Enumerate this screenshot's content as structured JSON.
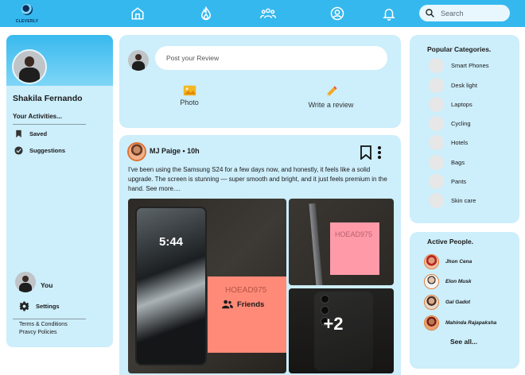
{
  "brand": {
    "name": "CLEVERLY"
  },
  "nav": {
    "search_placeholder": "Search"
  },
  "profile": {
    "name": "Shakila Fernando",
    "activities_title": "Your Activities...",
    "items": [
      {
        "label": "Saved",
        "icon": "bookmark-icon"
      },
      {
        "label": "Suggestions",
        "icon": "check-circle-icon"
      }
    ],
    "you_label": "You",
    "settings_label": "Settings",
    "terms_label": "Terms & Conditions",
    "privacy_label": "Pravcy Policies"
  },
  "composer": {
    "placeholder": "Post your Review",
    "photo_label": "Photo",
    "review_label": "Write a review"
  },
  "post": {
    "author": "MJ Paige",
    "time": "10h",
    "text": "I've been using the Samsung S24 for a few days now, and honestly, it feels like a solid  upgrade. The screen is stunning — super smooth and bright, and it just feels premium in the hand. See more....",
    "phone_time": "5:44",
    "friends_label": "Friends",
    "more_photos": "+2"
  },
  "categories": {
    "title": "Popular Categories.",
    "items": [
      "Smart Phones",
      "Desk light",
      "Laptops",
      "Cycling",
      "Hotels",
      "Bags",
      "Pants",
      "Skin care"
    ]
  },
  "people": {
    "title": "Active People.",
    "items": [
      "Jhon Cena",
      "Elon Musk",
      "Gal Gadot",
      "Mahinda Rajapaksha"
    ],
    "see_all": "See all..."
  },
  "colors": {
    "topbar": "#35b8ee",
    "panel": "#cdeefb",
    "accent_ring": "#e57a2e"
  }
}
